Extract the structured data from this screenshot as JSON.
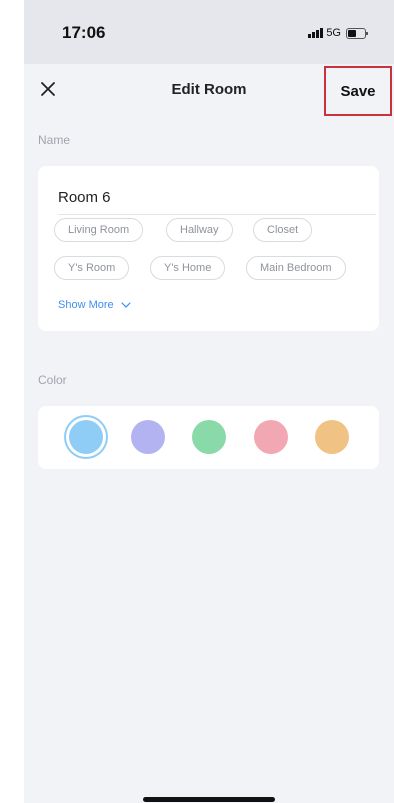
{
  "status_bar": {
    "time": "17:06",
    "network": "5G"
  },
  "header": {
    "title": "Edit Room",
    "save_label": "Save"
  },
  "name_section": {
    "label": "Name",
    "input_value": "Room 6",
    "suggestions": [
      "Living Room",
      "Hallway",
      "Closet",
      "Y's Room",
      "Y's Home",
      "Main Bedroom"
    ],
    "show_more_label": "Show More"
  },
  "color_section": {
    "label": "Color",
    "colors": [
      "#8fcdf7",
      "#b3b3f2",
      "#8ad9a8",
      "#f2a8b3",
      "#f0c283"
    ],
    "selected_index": 0
  }
}
